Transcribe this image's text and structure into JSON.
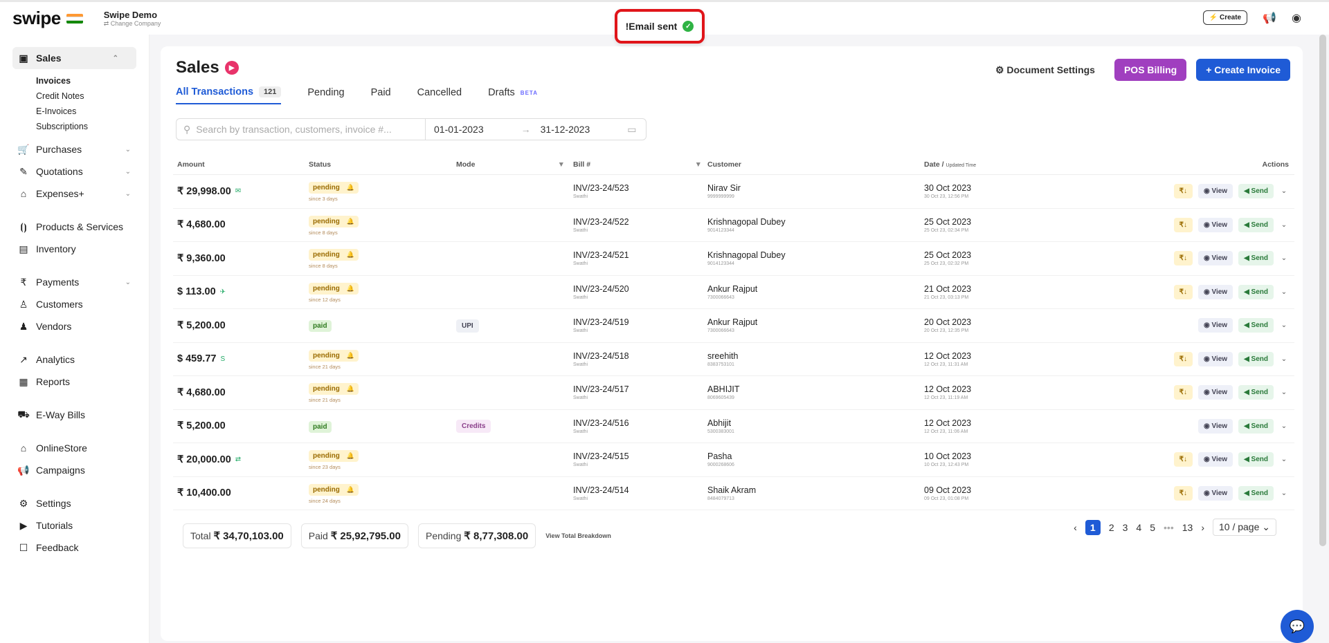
{
  "app": {
    "logo": "swipe",
    "company_name": "Swipe Demo",
    "company_sub": "⇄ Change Company"
  },
  "toast": {
    "text": "!Email sent"
  },
  "top_right": {
    "create_label": "Create"
  },
  "sidebar": {
    "items": [
      {
        "label": "Sales",
        "icon": "sales-icon",
        "glyph": "▣",
        "chev": "^",
        "active": true,
        "subs": [
          "Invoices",
          "Credit Notes",
          "E-Invoices",
          "Subscriptions"
        ]
      },
      {
        "label": "Purchases",
        "icon": "cart-icon",
        "glyph": "🛒",
        "chev": "v"
      },
      {
        "label": "Quotations",
        "icon": "pen-icon",
        "glyph": "✎",
        "chev": "v"
      },
      {
        "label": "Expenses+",
        "icon": "tag-icon",
        "glyph": "⌂",
        "chev": "v"
      },
      {
        "gap": true
      },
      {
        "label": "Products & Services",
        "icon": "products-icon",
        "glyph": "⦗⦘"
      },
      {
        "label": "Inventory",
        "icon": "inventory-icon",
        "glyph": "▤"
      },
      {
        "gap": true
      },
      {
        "label": "Payments",
        "icon": "rupee-icon",
        "glyph": "₹",
        "chev": "v"
      },
      {
        "label": "Customers",
        "icon": "user-icon",
        "glyph": "♙"
      },
      {
        "label": "Vendors",
        "icon": "users-icon",
        "glyph": "♟"
      },
      {
        "gap": true
      },
      {
        "label": "Analytics",
        "icon": "analytics-icon",
        "glyph": "↗"
      },
      {
        "label": "Reports",
        "icon": "reports-icon",
        "glyph": "▦"
      },
      {
        "gap": true
      },
      {
        "label": "E-Way Bills",
        "icon": "truck-icon",
        "glyph": "⛟"
      },
      {
        "gap": true
      },
      {
        "label": "OnlineStore",
        "icon": "store-icon",
        "glyph": "⌂"
      },
      {
        "label": "Campaigns",
        "icon": "megaphone-icon",
        "glyph": "📢"
      },
      {
        "gap": true
      },
      {
        "label": "Settings",
        "icon": "gear-icon",
        "glyph": "⚙"
      },
      {
        "label": "Tutorials",
        "icon": "youtube-icon",
        "glyph": "▶"
      },
      {
        "label": "Feedback",
        "icon": "feedback-icon",
        "glyph": "☐"
      }
    ]
  },
  "header": {
    "title": "Sales",
    "doc_settings": "Document Settings",
    "pos_billing": "POS Billing",
    "create_invoice": "Create Invoice"
  },
  "tabs": [
    {
      "label": "All Transactions",
      "count": "121",
      "active": true
    },
    {
      "label": "Pending"
    },
    {
      "label": "Paid"
    },
    {
      "label": "Cancelled"
    },
    {
      "label": "Drafts",
      "badge": "BETA"
    }
  ],
  "filter": {
    "search_placeholder": "Search by transaction, customers, invoice #...",
    "date_from": "01-01-2023",
    "date_to": "31-12-2023"
  },
  "columns": {
    "amount": "Amount",
    "status": "Status",
    "mode": "Mode",
    "bill": "Bill #",
    "customer": "Customer",
    "date": "Date / ",
    "date_sub": "Updated Time",
    "actions": "Actions"
  },
  "rows": [
    {
      "amount": "₹ 29,998.00",
      "amt_icon": "✉",
      "status": "pending",
      "since": "since 3 days",
      "mode": "",
      "bill": "INV/23-24/523",
      "bill_sub": "Swathi",
      "customer": "Nirav Sir",
      "cust_sub": "9999999999",
      "date": "30 Oct 2023",
      "date_sub": "30 Oct 23, 12:56 PM",
      "rupee_action": true
    },
    {
      "amount": "₹ 4,680.00",
      "amt_icon": "",
      "status": "pending",
      "since": "since 8 days",
      "mode": "",
      "bill": "INV/23-24/522",
      "bill_sub": "Swathi",
      "customer": "Krishnagopal Dubey",
      "cust_sub": "9014123344",
      "date": "25 Oct 2023",
      "date_sub": "25 Oct 23, 02:34 PM",
      "rupee_action": true
    },
    {
      "amount": "₹ 9,360.00",
      "amt_icon": "",
      "status": "pending",
      "since": "since 8 days",
      "mode": "",
      "bill": "INV/23-24/521",
      "bill_sub": "Swathi",
      "customer": "Krishnagopal Dubey",
      "cust_sub": "9014123344",
      "date": "25 Oct 2023",
      "date_sub": "25 Oct 23, 02:32 PM",
      "rupee_action": true
    },
    {
      "amount": "$ 113.00",
      "amt_icon": "✈",
      "status": "pending",
      "since": "since 12 days",
      "mode": "",
      "bill": "INV/23-24/520",
      "bill_sub": "Swathi",
      "customer": "Ankur Rajput",
      "cust_sub": "7300066643",
      "date": "21 Oct 2023",
      "date_sub": "21 Oct 23, 03:13 PM",
      "rupee_action": true
    },
    {
      "amount": "₹ 5,200.00",
      "amt_icon": "",
      "status": "paid",
      "since": "",
      "mode": "UPI",
      "mode_type": "upi",
      "bill": "INV/23-24/519",
      "bill_sub": "Swathi",
      "customer": "Ankur Rajput",
      "cust_sub": "7300066643",
      "date": "20 Oct 2023",
      "date_sub": "20 Oct 23, 12:35 PM",
      "rupee_action": false
    },
    {
      "amount": "$ 459.77",
      "amt_icon": "S",
      "status": "pending",
      "since": "since 21 days",
      "mode": "",
      "bill": "INV/23-24/518",
      "bill_sub": "Swathi",
      "customer": "sreehith",
      "cust_sub": "8383753101",
      "date": "12 Oct 2023",
      "date_sub": "12 Oct 23, 11:31 AM",
      "rupee_action": true
    },
    {
      "amount": "₹ 4,680.00",
      "amt_icon": "",
      "status": "pending",
      "since": "since 21 days",
      "mode": "",
      "bill": "INV/23-24/517",
      "bill_sub": "Swathi",
      "customer": "ABHIJIT",
      "cust_sub": "8069605439",
      "date": "12 Oct 2023",
      "date_sub": "12 Oct 23, 11:19 AM",
      "rupee_action": true
    },
    {
      "amount": "₹ 5,200.00",
      "amt_icon": "",
      "status": "paid",
      "since": "",
      "mode": "Credits",
      "mode_type": "credits",
      "bill": "INV/23-24/516",
      "bill_sub": "Swathi",
      "customer": "Abhijit",
      "cust_sub": "5300383001",
      "date": "12 Oct 2023",
      "date_sub": "12 Oct 23, 11:06 AM",
      "rupee_action": false
    },
    {
      "amount": "₹ 20,000.00",
      "amt_icon": "⇄",
      "status": "pending",
      "since": "since 23 days",
      "mode": "",
      "bill": "INV/23-24/515",
      "bill_sub": "Swathi",
      "customer": "Pasha",
      "cust_sub": "9000268606",
      "date": "10 Oct 2023",
      "date_sub": "10 Oct 23, 12:43 PM",
      "rupee_action": true
    },
    {
      "amount": "₹ 10,400.00",
      "amt_icon": "",
      "status": "pending",
      "since": "since 24 days",
      "mode": "",
      "bill": "INV/23-24/514",
      "bill_sub": "Swathi",
      "customer": "Shaik Akram",
      "cust_sub": "8484079713",
      "date": "09 Oct 2023",
      "date_sub": "09 Oct 23, 01:08 PM",
      "rupee_action": true
    }
  ],
  "actions": {
    "rupee": "₹↓",
    "view": "◉ View",
    "send": "◀ Send",
    "more": "⌄"
  },
  "summary": {
    "total_label": "Total",
    "total_value": "₹ 34,70,103.00",
    "paid_label": "Paid",
    "paid_value": "₹ 25,92,795.00",
    "pending_label": "Pending",
    "pending_value": "₹ 8,77,308.00",
    "breakdown": "View Total Breakdown"
  },
  "pager": {
    "pages": [
      "1",
      "2",
      "3",
      "4",
      "5",
      "•••",
      "13"
    ],
    "current": "1",
    "per_page": "10 / page"
  },
  "colors": {
    "primary": "#1f5bd6",
    "pos": "#a03fbf",
    "toast_border": "#e0151a"
  }
}
